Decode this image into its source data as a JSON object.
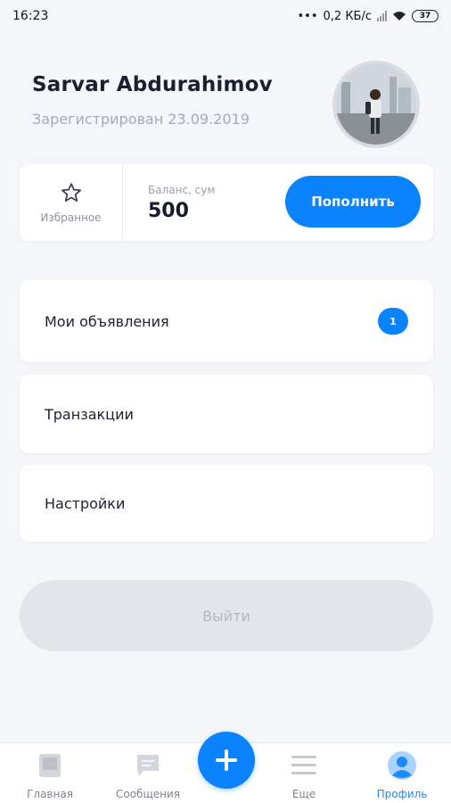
{
  "status_bar": {
    "time": "16:23",
    "network_speed": "0,2 КБ/с",
    "battery": "37"
  },
  "profile": {
    "name": "Sarvar Abdurahimov",
    "registered": "Зарегистрирован 23.09.2019",
    "avatar_icon": "user-photo"
  },
  "summary": {
    "favorites_label": "Избранное",
    "balance_caption": "Баланс, сум",
    "balance_value": "500",
    "topup_label": "Пополнить"
  },
  "menu": {
    "items": [
      {
        "label": "Мои объявления",
        "badge": "1"
      },
      {
        "label": "Транзакции"
      },
      {
        "label": "Настройки"
      }
    ]
  },
  "logout_label": "Выйти",
  "tabbar": {
    "items": [
      {
        "label": "Главная",
        "icon": "home-icon"
      },
      {
        "label": "Сообщения",
        "icon": "message-icon"
      },
      {
        "label": "Еще",
        "icon": "menu-icon"
      },
      {
        "label": "Профиль",
        "icon": "profile-icon",
        "active": true
      }
    ],
    "fab_icon": "plus-icon"
  },
  "colors": {
    "accent": "#0b83ff",
    "background": "#f4f6f9",
    "muted": "#a5aab5"
  }
}
